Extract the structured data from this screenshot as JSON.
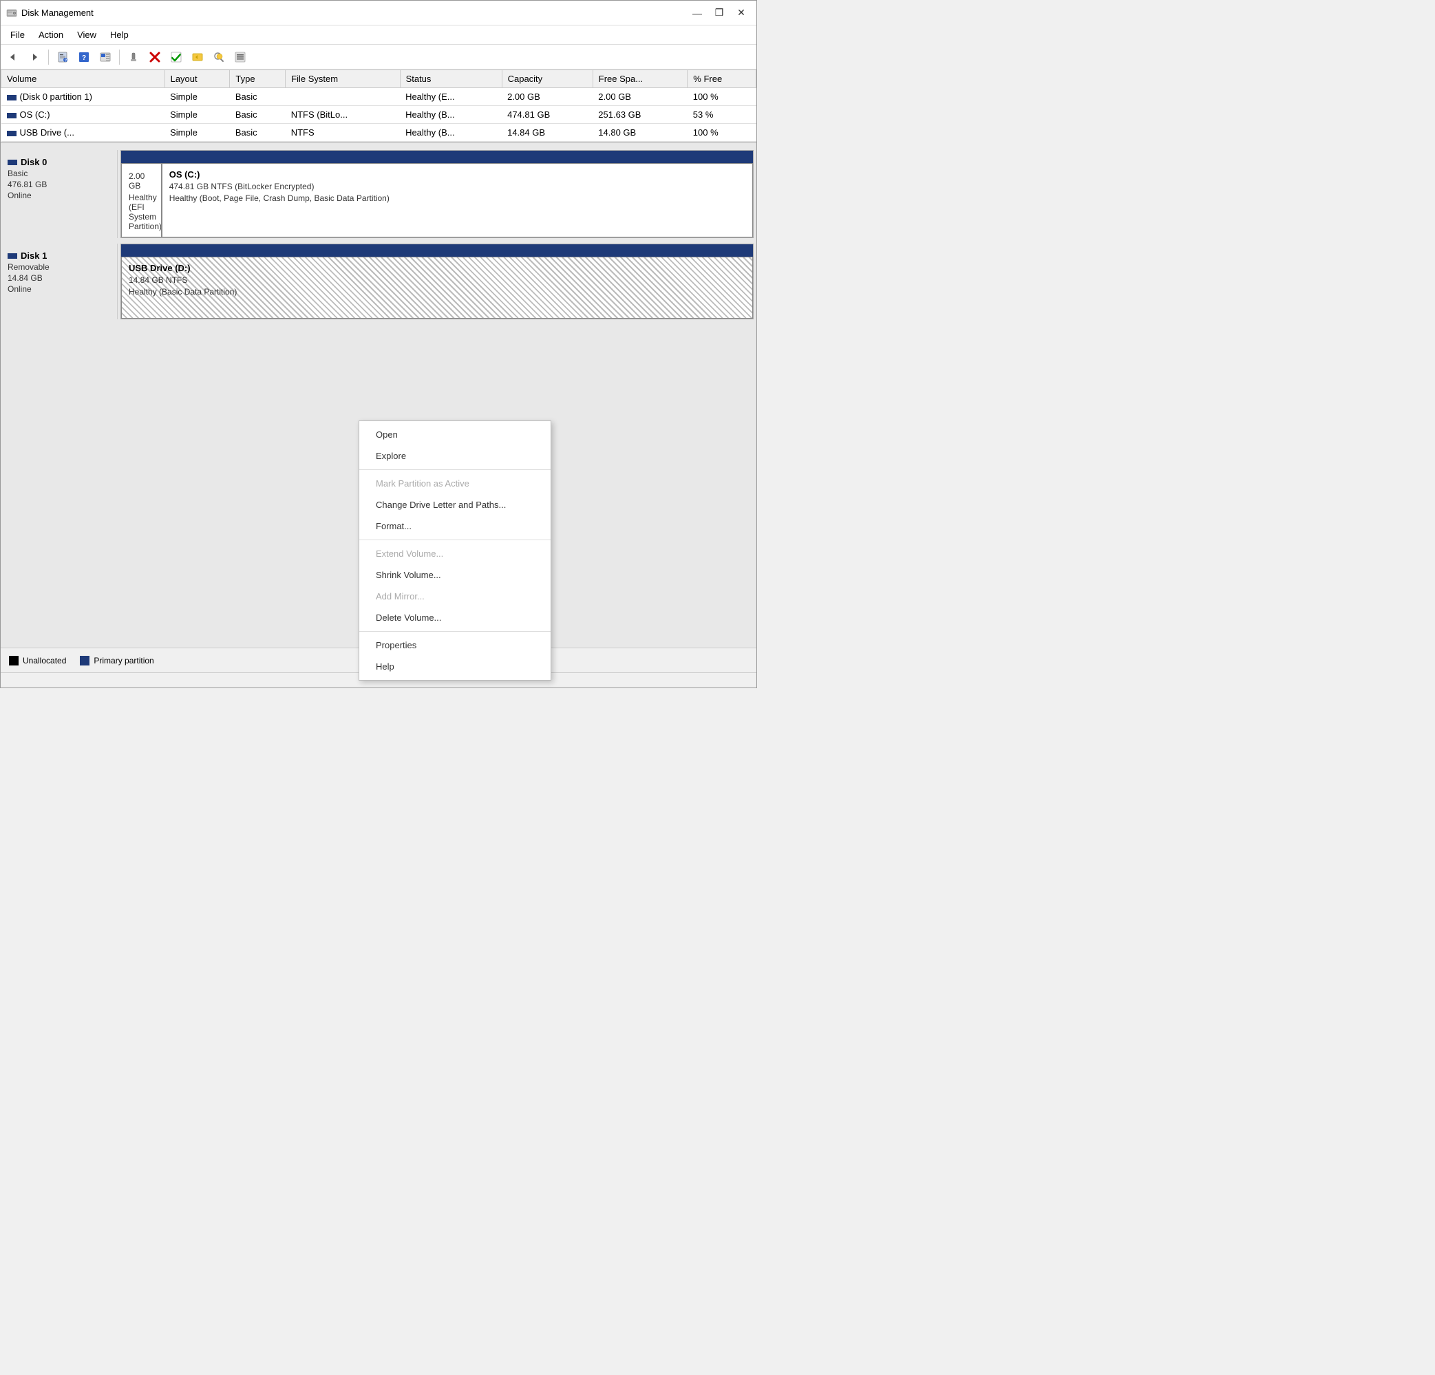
{
  "window": {
    "title": "Disk Management",
    "icon": "disk-management-icon"
  },
  "titlebar": {
    "buttons": {
      "minimize": "—",
      "restore": "❒",
      "close": "✕"
    }
  },
  "menubar": {
    "items": [
      "File",
      "Action",
      "View",
      "Help"
    ]
  },
  "toolbar": {
    "buttons": [
      {
        "name": "back",
        "icon": "←"
      },
      {
        "name": "forward",
        "icon": "→"
      },
      {
        "name": "properties",
        "icon": "📋"
      },
      {
        "name": "help",
        "icon": "?"
      },
      {
        "name": "view-details",
        "icon": "▤"
      },
      {
        "name": "connect",
        "icon": "🔌"
      },
      {
        "name": "delete",
        "icon": "✖"
      },
      {
        "name": "check",
        "icon": "✓"
      },
      {
        "name": "add-disk",
        "icon": "⊕"
      },
      {
        "name": "search",
        "icon": "🔍"
      },
      {
        "name": "settings",
        "icon": "≡"
      }
    ]
  },
  "table": {
    "columns": [
      "Volume",
      "Layout",
      "Type",
      "File System",
      "Status",
      "Capacity",
      "Free Spa...",
      "% Free"
    ],
    "rows": [
      {
        "volume": "(Disk 0 partition 1)",
        "layout": "Simple",
        "type": "Basic",
        "filesystem": "",
        "status": "Healthy (E...",
        "capacity": "2.00 GB",
        "free_space": "2.00 GB",
        "pct_free": "100 %",
        "has_icon": true
      },
      {
        "volume": "OS (C:)",
        "layout": "Simple",
        "type": "Basic",
        "filesystem": "NTFS (BitLo...",
        "status": "Healthy (B...",
        "capacity": "474.81 GB",
        "free_space": "251.63 GB",
        "pct_free": "53 %",
        "has_icon": true
      },
      {
        "volume": "USB Drive (...",
        "layout": "Simple",
        "type": "Basic",
        "filesystem": "NTFS",
        "status": "Healthy (B...",
        "capacity": "14.84 GB",
        "free_space": "14.80 GB",
        "pct_free": "100 %",
        "has_icon": true
      }
    ]
  },
  "disks": [
    {
      "name": "Disk 0",
      "type": "Basic",
      "size": "476.81 GB",
      "status": "Online",
      "partitions": [
        {
          "label": "",
          "size": "2.00 GB",
          "detail": "Healthy (EFI System Partition)",
          "style": "white",
          "flex": 0.42,
          "bar_color": "#1e3a78"
        },
        {
          "label": "OS  (C:)",
          "size": "474.81 GB NTFS (BitLocker Encrypted)",
          "detail": "Healthy (Boot, Page File, Crash Dump, Basic Data Partition)",
          "style": "white",
          "flex": 9.58,
          "bar_color": "#1e3a78",
          "is_labeled": true
        }
      ]
    },
    {
      "name": "Disk 1",
      "type": "Removable",
      "size": "14.84 GB",
      "status": "Online",
      "partitions": [
        {
          "label": "USB Drive  (D:)",
          "size": "14.84 GB NTFS",
          "detail": "Healthy (Basic Data Partition)",
          "style": "hatch",
          "flex": 1,
          "bar_color": "#1e3a78",
          "is_labeled": true
        }
      ]
    }
  ],
  "context_menu": {
    "items": [
      {
        "label": "Open",
        "disabled": false,
        "separator_after": false
      },
      {
        "label": "Explore",
        "disabled": false,
        "separator_after": true
      },
      {
        "label": "Mark Partition as Active",
        "disabled": true,
        "separator_after": false
      },
      {
        "label": "Change Drive Letter and Paths...",
        "disabled": false,
        "separator_after": false
      },
      {
        "label": "Format...",
        "disabled": false,
        "separator_after": true
      },
      {
        "label": "Extend Volume...",
        "disabled": true,
        "separator_after": false
      },
      {
        "label": "Shrink Volume...",
        "disabled": false,
        "separator_after": false
      },
      {
        "label": "Add Mirror...",
        "disabled": true,
        "separator_after": false
      },
      {
        "label": "Delete Volume...",
        "disabled": false,
        "separator_after": true
      },
      {
        "label": "Properties",
        "disabled": false,
        "separator_after": false
      },
      {
        "label": "Help",
        "disabled": false,
        "separator_after": false
      }
    ]
  },
  "legend": {
    "items": [
      {
        "label": "Unallocated",
        "color": "black"
      },
      {
        "label": "Primary partition",
        "color": "blue"
      }
    ]
  }
}
